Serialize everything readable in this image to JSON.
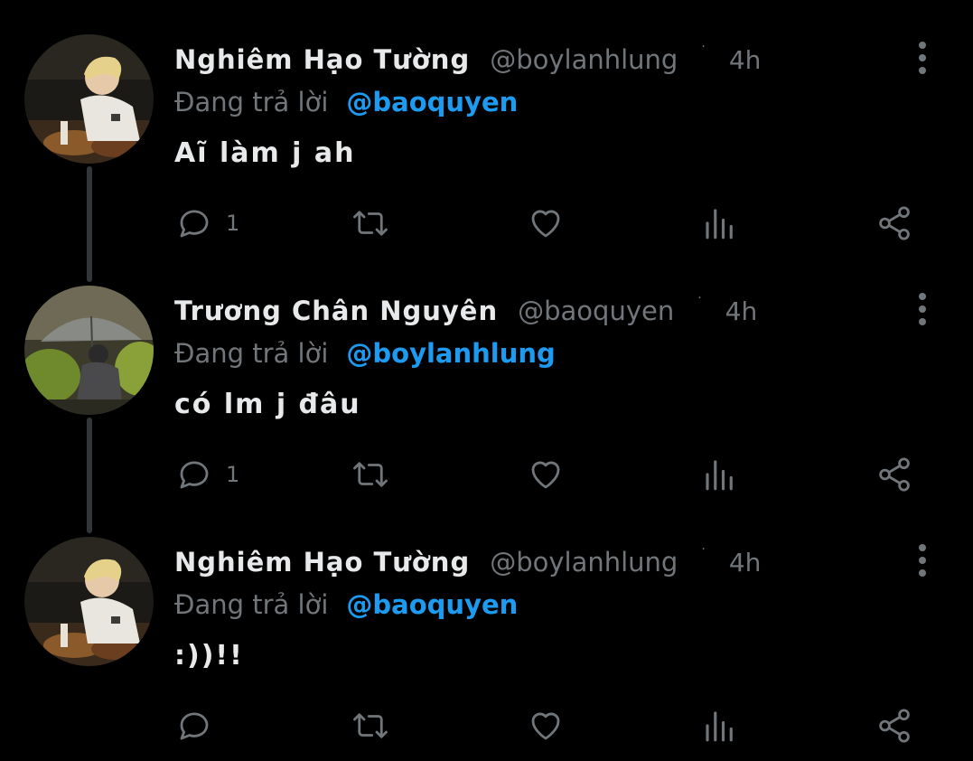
{
  "icons": {
    "reply": "speech-bubble-icon",
    "retweet": "retweet-arrows-icon",
    "like": "heart-icon",
    "views": "bar-chart-icon",
    "share": "share-nodes-icon",
    "more": "vertical-dots-icon"
  },
  "colors": {
    "background": "#000000",
    "text_primary": "#e7e9ea",
    "text_secondary": "#71767b",
    "mention": "#1d9bf0",
    "thread_line": "#333639"
  },
  "tweets": [
    {
      "display_name": "Nghiêm Hạo Tường",
      "handle": "@boylanhlung",
      "dot": "·",
      "time": "4h",
      "reply_prefix": "Đang trả lời",
      "reply_to": "@baoquyen",
      "text": "Aĩ làm j ah",
      "reply_count": "1"
    },
    {
      "display_name": "Trương Chân Nguyên",
      "handle": "@baoquyen",
      "dot": "·",
      "time": "4h",
      "reply_prefix": "Đang trả lời",
      "reply_to": "@boylanhlung",
      "text": "có lm j đâu",
      "reply_count": "1"
    },
    {
      "display_name": "Nghiêm Hạo Tường",
      "handle": "@boylanhlung",
      "dot": "·",
      "time": "4h",
      "reply_prefix": "Đang trả lời",
      "reply_to": "@baoquyen",
      "text": ":))!!",
      "reply_count": ""
    }
  ]
}
